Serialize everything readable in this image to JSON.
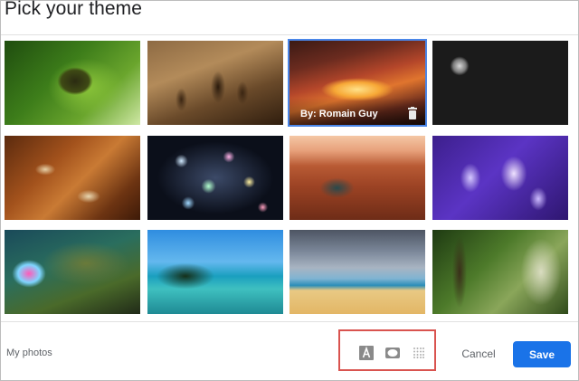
{
  "dialog": {
    "title": "Pick your theme",
    "footer": {
      "my_photos_label": "My photos",
      "cancel_label": "Cancel",
      "save_label": "Save"
    }
  },
  "themes": [
    {
      "name": "caterpillar",
      "selected": false
    },
    {
      "name": "chess-pieces",
      "selected": false
    },
    {
      "name": "canyon-light",
      "selected": true,
      "credit": "By: Romain Guy"
    },
    {
      "name": "metal-pipes",
      "selected": false
    },
    {
      "name": "autumn-leaves",
      "selected": false
    },
    {
      "name": "bokeh-lights",
      "selected": false
    },
    {
      "name": "river-canyon",
      "selected": false
    },
    {
      "name": "jellyfish",
      "selected": false
    },
    {
      "name": "abstract-reflection",
      "selected": false
    },
    {
      "name": "lake-island",
      "selected": false
    },
    {
      "name": "beach-sky",
      "selected": false
    },
    {
      "name": "forest-waterfall",
      "selected": false
    }
  ],
  "toolbar_icons": [
    "text-background-icon",
    "vignette-icon",
    "blur-icon"
  ],
  "colors": {
    "accent": "#1a73e8",
    "selection_outline": "#4a86e8",
    "highlight_box": "#d9534f"
  }
}
